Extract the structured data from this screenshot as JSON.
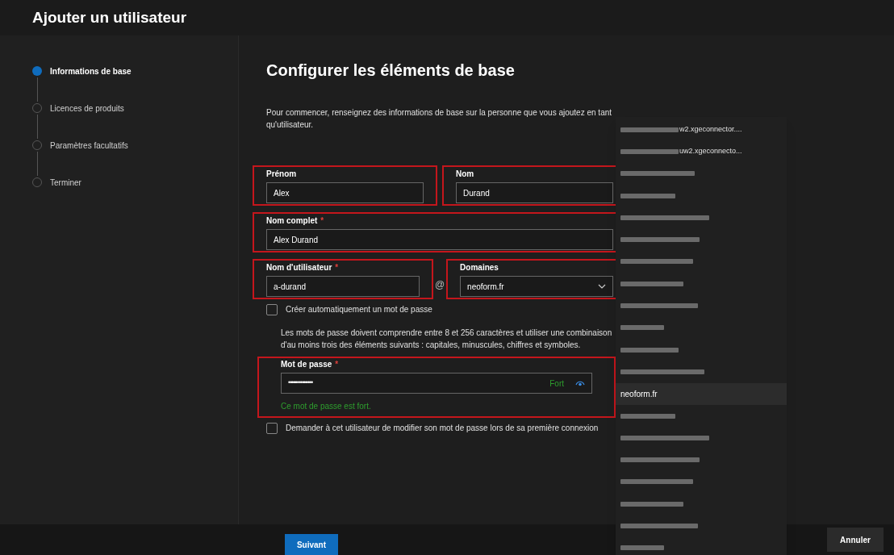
{
  "window": {
    "title": "Ajouter un utilisateur"
  },
  "steps": [
    {
      "label": "Informations de base",
      "selected": true
    },
    {
      "label": "Licences de produits",
      "selected": false
    },
    {
      "label": "Paramètres facultatifs",
      "selected": false
    },
    {
      "label": "Terminer",
      "selected": false
    }
  ],
  "main": {
    "heading": "Configurer les éléments de base",
    "intro": "Pour commencer, renseignez des informations de base sur la personne que vous ajoutez en tant qu'utilisateur."
  },
  "form_rows": [
    {
      "fields": [
        {
          "kind": "text",
          "label": "Prénom",
          "value": "Alex",
          "highlighted": true
        },
        {
          "kind": "text",
          "label": "Nom",
          "value": "Durand",
          "highlighted": true
        }
      ]
    },
    {
      "fields": [
        {
          "kind": "text",
          "label": "Nom complet",
          "required_mark": "*",
          "value": "Alex Durand",
          "highlighted": true
        }
      ]
    },
    {
      "separator": "@",
      "fields": [
        {
          "kind": "text",
          "label": "Nom d'utilisateur",
          "required_mark": "*",
          "value": "a-durand",
          "highlighted": true
        },
        {
          "kind": "select",
          "label": "Domaines",
          "value": "neoform.fr",
          "highlighted": true
        }
      ]
    }
  ],
  "auto_password": {
    "label": "Créer automatiquement un mot de passe",
    "checked": false
  },
  "password_hint": "Les mots de passe doivent comprendre entre 8 et 256 caractères et utiliser une combinaison d'au moins trois des éléments suivants : capitales, minuscules, chiffres et symboles.",
  "password": {
    "label": "Mot de passe",
    "required_mark": "*",
    "value": "••••••••••••••",
    "strength": "Fort",
    "message": "Ce mot de passe est fort.",
    "highlighted": true
  },
  "force_change": {
    "label": "Demander à cet utilisateur de modifier son mot de passe lors de sa première connexion",
    "checked": false
  },
  "domain_dropdown": [
    {
      "kind": "partial",
      "text": "w2.xgeconnector....",
      "selected": false
    },
    {
      "kind": "partial",
      "text": "uw2.xgeconnecto...",
      "selected": false
    },
    {
      "kind": "redacted",
      "selected": false
    },
    {
      "kind": "redacted",
      "selected": false
    },
    {
      "kind": "redacted",
      "selected": false
    },
    {
      "kind": "redacted",
      "selected": false
    },
    {
      "kind": "redacted",
      "selected": false
    },
    {
      "kind": "redacted",
      "selected": false
    },
    {
      "kind": "redacted",
      "selected": false
    },
    {
      "kind": "redacted",
      "selected": false
    },
    {
      "kind": "redacted",
      "selected": false
    },
    {
      "kind": "redacted",
      "selected": false
    },
    {
      "kind": "text",
      "text": "neoform.fr",
      "selected": true
    },
    {
      "kind": "redacted",
      "selected": false
    },
    {
      "kind": "redacted",
      "selected": false
    },
    {
      "kind": "redacted",
      "selected": false
    },
    {
      "kind": "redacted",
      "selected": false
    },
    {
      "kind": "redacted",
      "selected": false
    },
    {
      "kind": "redacted",
      "selected": false
    },
    {
      "kind": "redacted",
      "selected": false
    }
  ],
  "footer": {
    "next": "Suivant",
    "cancel": "Annuler"
  }
}
